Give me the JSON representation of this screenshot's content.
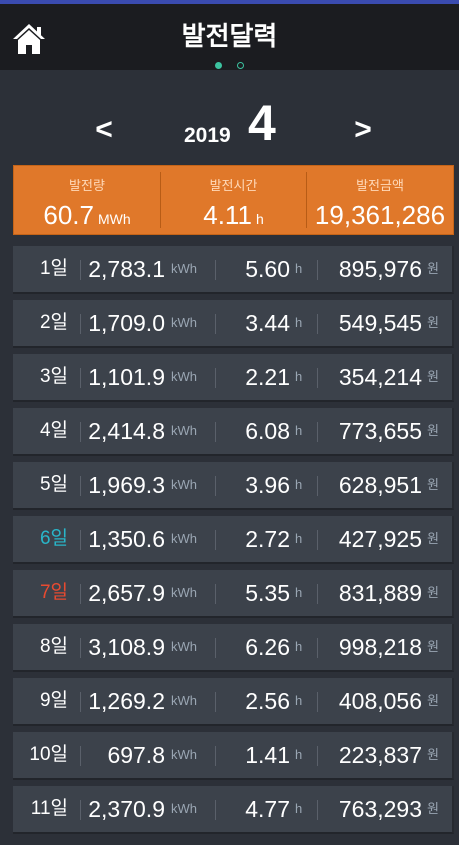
{
  "header": {
    "title": "발전달력",
    "home_icon": "home-icon",
    "pager": {
      "total": 2,
      "active": 1
    }
  },
  "nav": {
    "prev": "<",
    "next": ">",
    "year": "2019",
    "month": "4"
  },
  "summary": {
    "energy": {
      "label": "발전량",
      "value": "60.7",
      "unit": "MWh"
    },
    "hours": {
      "label": "발전시간",
      "value": "4.11",
      "unit": "h"
    },
    "amount": {
      "label": "발전금액",
      "value": "19,361,286"
    }
  },
  "units": {
    "energy": "kWh",
    "hours": "h",
    "amount": "원"
  },
  "colors": {
    "accent": "#e0782a",
    "saturday": "#29b6c9",
    "sunday": "#e84a30",
    "pager": "#3cc3a0"
  },
  "rows": [
    {
      "day": "1일",
      "energy": "2,783.1",
      "hours": "5.60",
      "amount": "895,976",
      "type": ""
    },
    {
      "day": "2일",
      "energy": "1,709.0",
      "hours": "3.44",
      "amount": "549,545",
      "type": ""
    },
    {
      "day": "3일",
      "energy": "1,101.9",
      "hours": "2.21",
      "amount": "354,214",
      "type": ""
    },
    {
      "day": "4일",
      "energy": "2,414.8",
      "hours": "6.08",
      "amount": "773,655",
      "type": ""
    },
    {
      "day": "5일",
      "energy": "1,969.3",
      "hours": "3.96",
      "amount": "628,951",
      "type": ""
    },
    {
      "day": "6일",
      "energy": "1,350.6",
      "hours": "2.72",
      "amount": "427,925",
      "type": "sat"
    },
    {
      "day": "7일",
      "energy": "2,657.9",
      "hours": "5.35",
      "amount": "831,889",
      "type": "sun"
    },
    {
      "day": "8일",
      "energy": "3,108.9",
      "hours": "6.26",
      "amount": "998,218",
      "type": ""
    },
    {
      "day": "9일",
      "energy": "1,269.2",
      "hours": "2.56",
      "amount": "408,056",
      "type": ""
    },
    {
      "day": "10일",
      "energy": "697.8",
      "hours": "1.41",
      "amount": "223,837",
      "type": ""
    },
    {
      "day": "11일",
      "energy": "2,370.9",
      "hours": "4.77",
      "amount": "763,293",
      "type": ""
    }
  ]
}
